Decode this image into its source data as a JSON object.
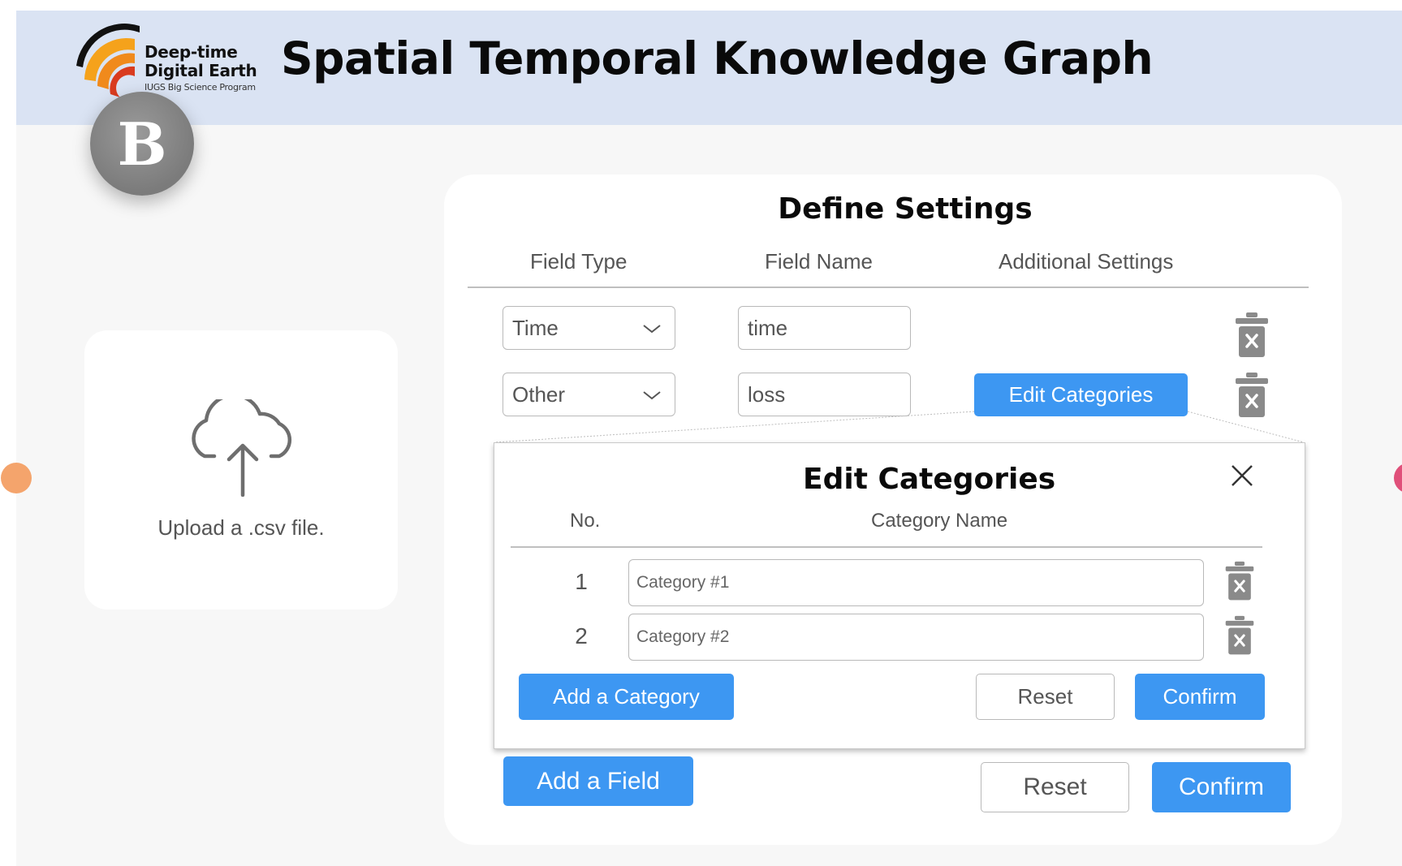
{
  "header": {
    "title": "Spatial Temporal Knowledge Graph",
    "logo": {
      "line1": "Deep-time",
      "line2": "Digital Earth",
      "line3": "IUGS Big Science Program"
    },
    "colors": {
      "band": "#dae3f3"
    }
  },
  "badge": {
    "letter": "B"
  },
  "upload": {
    "icon": "cloud-upload-icon",
    "label": "Upload a .csv file."
  },
  "settings": {
    "title": "Define Settings",
    "columns": [
      "Field Type",
      "Field Name",
      "Additional Settings"
    ],
    "fields": [
      {
        "type": "Time",
        "name": "time",
        "additional": ""
      },
      {
        "type": "Other",
        "name": "loss",
        "additional": "Edit Categories"
      }
    ],
    "add_field_label": "Add a Field",
    "reset_label": "Reset",
    "confirm_label": "Confirm"
  },
  "edit_categories": {
    "title": "Edit Categories",
    "columns": [
      "No.",
      "Category Name"
    ],
    "rows": [
      {
        "no": "1",
        "placeholder": "Category #1"
      },
      {
        "no": "2",
        "placeholder": "Category #2"
      }
    ],
    "add_label": "Add a Category",
    "reset_label": "Reset",
    "confirm_label": "Confirm"
  },
  "colors": {
    "primary": "#3d97f2",
    "dot_left": "#f4a46c",
    "dot_right": "#e0507a"
  }
}
